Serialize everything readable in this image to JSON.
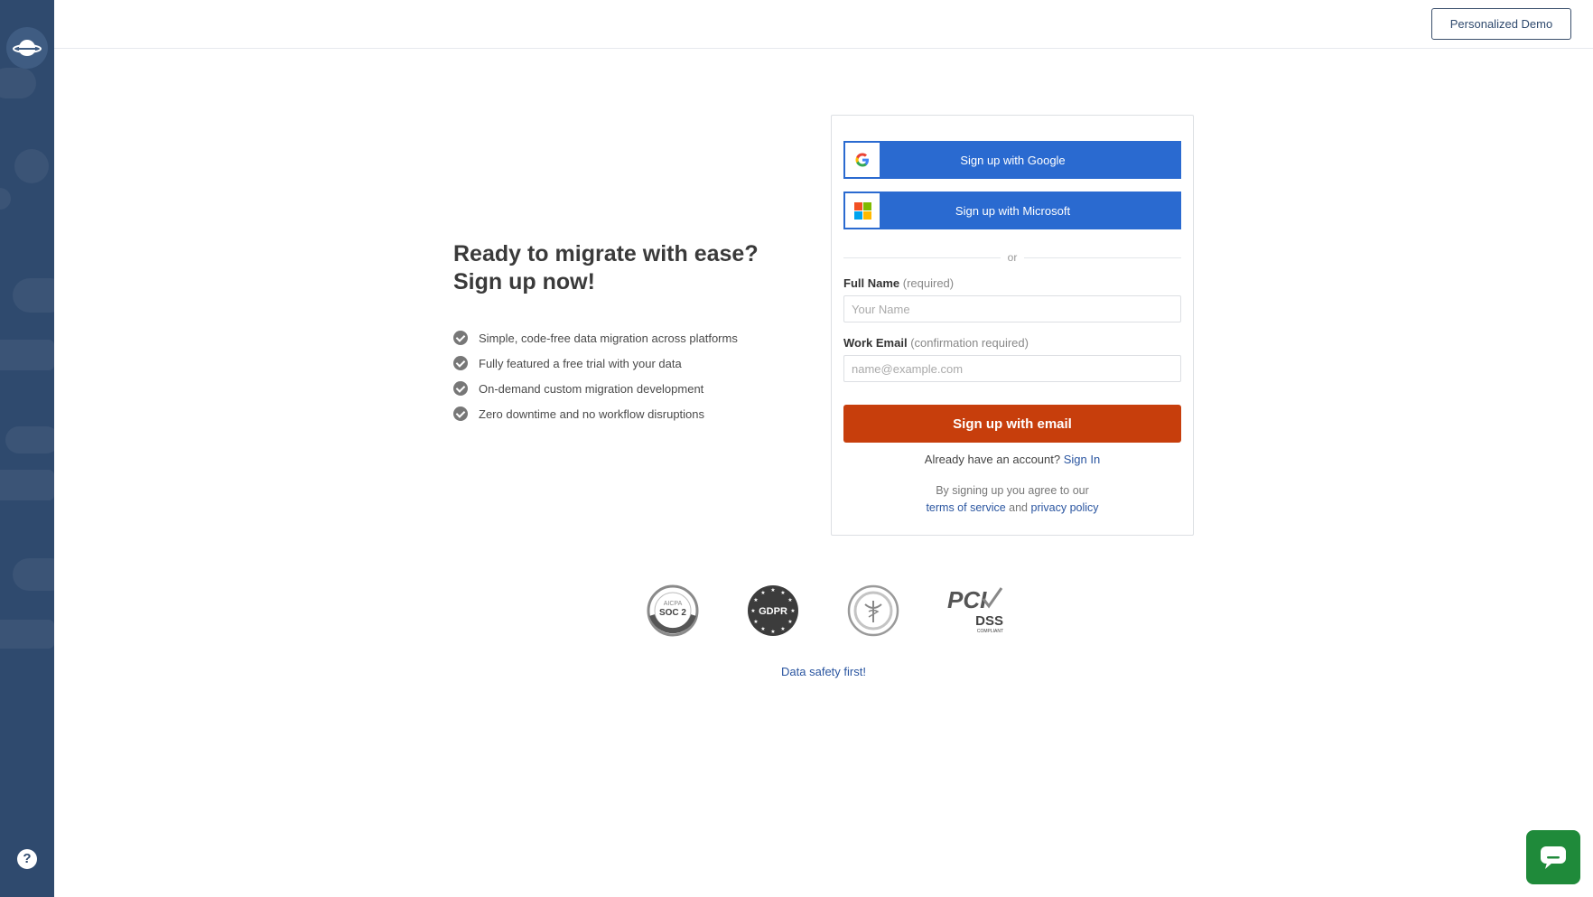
{
  "header": {
    "demo_button": "Personalized Demo"
  },
  "pitch": {
    "title_line1": "Ready to migrate with ease?",
    "title_line2": "Sign up now!",
    "features": [
      "Simple, code-free data migration across platforms",
      "Fully featured a free trial with your data",
      "On-demand custom migration development",
      "Zero downtime and no workflow disruptions"
    ]
  },
  "form": {
    "google_label": "Sign up with Google",
    "microsoft_label": "Sign up with Microsoft",
    "or_label": "or",
    "full_name_label": "Full Name",
    "full_name_hint": "(required)",
    "full_name_placeholder": "Your Name",
    "email_label": "Work Email",
    "email_hint": "(confirmation required)",
    "email_placeholder": "name@example.com",
    "submit_label": "Sign up with email",
    "already_text": "Already have an account?",
    "sign_in_link": "Sign In",
    "legal_prefix": "By signing up you agree to our",
    "terms_link": "terms of service",
    "legal_and": "and",
    "privacy_link": "privacy policy"
  },
  "badges": {
    "soc2_top": "AICPA",
    "soc2_main": "SOC 2",
    "gdpr": "GDPR",
    "pci": "PCI",
    "dss": "DSS",
    "compliant": "COMPLIANT"
  },
  "footer": {
    "safety_text": "Data safety first!"
  },
  "colors": {
    "sidebar": "#2f4a6e",
    "sso_blue": "#2a6ad0",
    "submit_orange": "#c73e0c",
    "chat_green": "#1f8a3a",
    "link_blue": "#2a55a0"
  },
  "icons": {
    "logo": "saturn-logo-icon",
    "help": "question-icon",
    "check": "check-circle-icon",
    "google": "google-g-icon",
    "microsoft": "microsoft-logo-icon",
    "chat": "chat-bubble-icon"
  }
}
